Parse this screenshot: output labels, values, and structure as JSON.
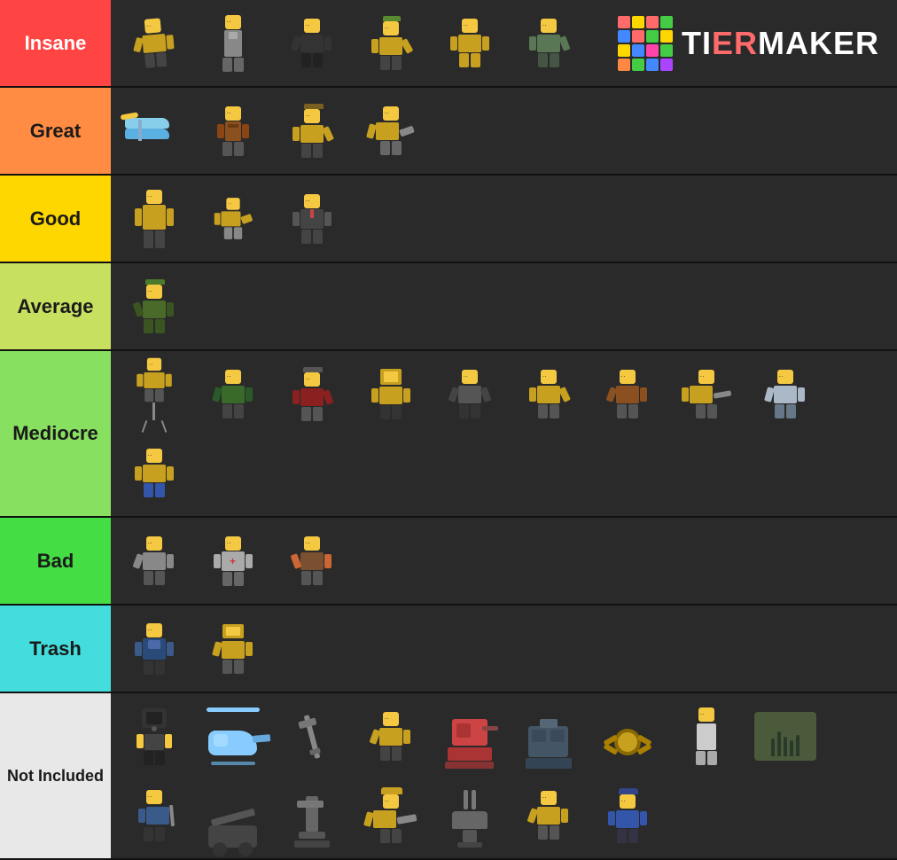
{
  "tiers": [
    {
      "id": "insane",
      "label": "Insane",
      "color": "#ff4444",
      "items": [
        {
          "id": "i1",
          "color": "#c8a020",
          "bodyColor": "#c8a020",
          "legColor": "#333"
        },
        {
          "id": "i2",
          "color": "#f5c842",
          "bodyColor": "#888",
          "legColor": "#555"
        },
        {
          "id": "i3",
          "color": "#f5c842",
          "bodyColor": "#333",
          "legColor": "#222"
        },
        {
          "id": "i4",
          "color": "#f5c842",
          "bodyColor": "#c8a020",
          "legColor": "#333"
        },
        {
          "id": "i5",
          "color": "#f5c842",
          "bodyColor": "#c8a020",
          "legColor": "#c8a020"
        },
        {
          "id": "i6",
          "color": "#f5c842",
          "bodyColor": "#777",
          "legColor": "#555"
        }
      ]
    },
    {
      "id": "great",
      "label": "Great",
      "color": "#ff8c42",
      "items": [
        {
          "id": "g1",
          "color": "#87ceeb",
          "bodyColor": "#87ceeb",
          "legColor": "#555"
        },
        {
          "id": "g2",
          "color": "#f5c842",
          "bodyColor": "#8b4513",
          "legColor": "#555"
        },
        {
          "id": "g3",
          "color": "#f5c842",
          "bodyColor": "#c8a020",
          "legColor": "#333"
        },
        {
          "id": "g4",
          "color": "#f5c842",
          "bodyColor": "#c8a020",
          "legColor": "#666"
        }
      ]
    },
    {
      "id": "good",
      "label": "Good",
      "color": "#ffd700",
      "items": [
        {
          "id": "go1",
          "color": "#f5c842",
          "bodyColor": "#c8a020",
          "legColor": "#333"
        },
        {
          "id": "go2",
          "color": "#f5c842",
          "bodyColor": "#c8a020",
          "legColor": "#888"
        },
        {
          "id": "go3",
          "color": "#f5c842",
          "bodyColor": "#666",
          "legColor": "#444"
        }
      ]
    },
    {
      "id": "average",
      "label": "Average",
      "color": "#c8e060",
      "items": [
        {
          "id": "av1",
          "color": "#f5c842",
          "bodyColor": "#4a6a2a",
          "legColor": "#3a5520"
        }
      ]
    },
    {
      "id": "mediocre",
      "label": "Mediocre",
      "color": "#88e060",
      "items": [
        {
          "id": "m1",
          "color": "#f5c842",
          "bodyColor": "#c8a020",
          "legColor": "#555"
        },
        {
          "id": "m2",
          "color": "#f5c842",
          "bodyColor": "#3a6a2a",
          "legColor": "#444"
        },
        {
          "id": "m3",
          "color": "#f5c842",
          "bodyColor": "#8b2020",
          "legColor": "#555"
        },
        {
          "id": "m4",
          "color": "#f5c842",
          "bodyColor": "#c8a020",
          "legColor": "#333"
        },
        {
          "id": "m5",
          "color": "#f5c842",
          "bodyColor": "#555",
          "legColor": "#333"
        },
        {
          "id": "m6",
          "color": "#f5c842",
          "bodyColor": "#c8a020",
          "legColor": "#555"
        },
        {
          "id": "m7",
          "color": "#f5c842",
          "bodyColor": "#8b5020",
          "legColor": "#555"
        },
        {
          "id": "m8",
          "color": "#f5c842",
          "bodyColor": "#c8a020",
          "legColor": "#555"
        },
        {
          "id": "m9",
          "color": "#f5c842",
          "bodyColor": "#aab8c8",
          "legColor": "#667788"
        },
        {
          "id": "m10",
          "color": "#f5c842",
          "bodyColor": "#c8a020",
          "legColor": "#555"
        }
      ]
    },
    {
      "id": "bad",
      "label": "Bad",
      "color": "#44dd44",
      "items": [
        {
          "id": "b1",
          "color": "#f5c842",
          "bodyColor": "#888",
          "legColor": "#555"
        },
        {
          "id": "b2",
          "color": "#f5c842",
          "bodyColor": "#aaaaaa",
          "legColor": "#666"
        },
        {
          "id": "b3",
          "color": "#f5c842",
          "bodyColor": "#7a5030",
          "legColor": "#555"
        }
      ]
    },
    {
      "id": "trash",
      "label": "Trash",
      "color": "#44dddd",
      "items": [
        {
          "id": "t1",
          "color": "#f5c842",
          "bodyColor": "#3a5a8a",
          "legColor": "#333"
        },
        {
          "id": "t2",
          "color": "#f5c842",
          "bodyColor": "#c8a020",
          "legColor": "#555"
        }
      ]
    },
    {
      "id": "not-included",
      "label": "Not Included",
      "color": "#e8e8e8",
      "items": [
        {
          "id": "n1",
          "color": "#f5c842",
          "bodyColor": "#333",
          "legColor": "#222"
        },
        {
          "id": "n2",
          "color": "#88ccff",
          "bodyColor": "#88ccff",
          "legColor": "#555"
        },
        {
          "id": "n3",
          "color": "#888",
          "bodyColor": "#777",
          "legColor": "#555"
        },
        {
          "id": "n4",
          "color": "#f5c842",
          "bodyColor": "#c8a020",
          "legColor": "#333"
        },
        {
          "id": "n5",
          "color": "#aaaaaa",
          "bodyColor": "#cc4444",
          "legColor": "#444"
        },
        {
          "id": "n6",
          "color": "#aaaaaa",
          "bodyColor": "#445566",
          "legColor": "#334"
        },
        {
          "id": "n7",
          "color": "#888",
          "bodyColor": "#777",
          "legColor": "#555"
        },
        {
          "id": "n8",
          "color": "#c8a020",
          "bodyColor": "#c8a020",
          "legColor": "#666"
        },
        {
          "id": "n9",
          "color": "#f5c842",
          "bodyColor": "#f5c842",
          "legColor": "#777"
        },
        {
          "id": "n10",
          "color": "#888",
          "bodyColor": "#667755",
          "legColor": "#445533"
        },
        {
          "id": "n11",
          "color": "#f5c842",
          "bodyColor": "#3a5a8a",
          "legColor": "#333"
        },
        {
          "id": "n12",
          "color": "#f5c842",
          "bodyColor": "#888",
          "legColor": "#555"
        },
        {
          "id": "n13",
          "color": "#888",
          "bodyColor": "#666",
          "legColor": "#444"
        },
        {
          "id": "n14",
          "color": "#f5c842",
          "bodyColor": "#c8a020",
          "legColor": "#444"
        },
        {
          "id": "n15",
          "color": "#888",
          "bodyColor": "#777",
          "legColor": "#556"
        },
        {
          "id": "n16",
          "color": "#f5c842",
          "bodyColor": "#c8a020",
          "legColor": "#555"
        },
        {
          "id": "n17",
          "color": "#f5c842",
          "bodyColor": "#3355aa",
          "legColor": "#334"
        }
      ]
    }
  ],
  "logo": {
    "text": "TiERMAKER",
    "colors": [
      "#ff6b6b",
      "#ffd700",
      "#44cc44",
      "#4488ff",
      "#ff44ff",
      "#44dddd",
      "#ff8844",
      "#8844ff",
      "#44ff88",
      "#ffaa44",
      "#44aaff",
      "#ff4488",
      "#88ff44",
      "#aa44ff",
      "#ff8844",
      "#44ffcc"
    ]
  }
}
